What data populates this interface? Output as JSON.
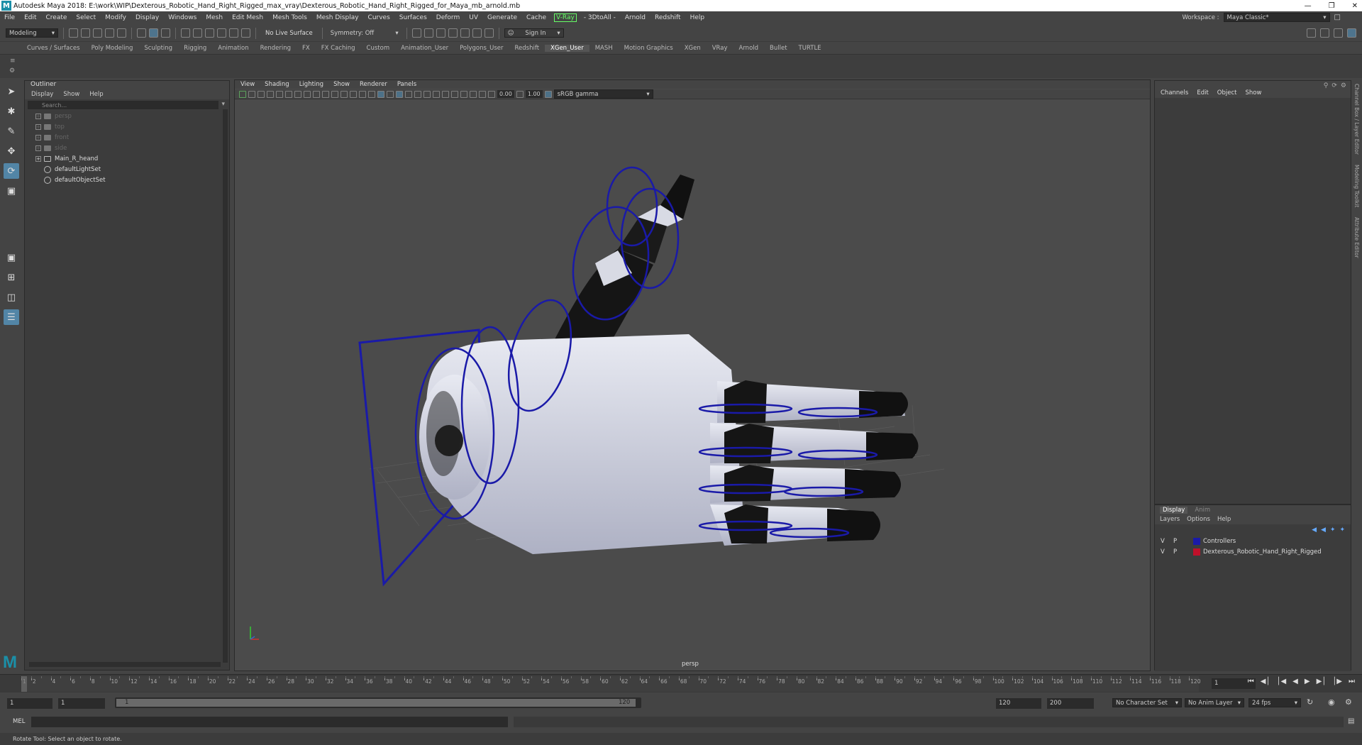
{
  "window": {
    "title": "Autodesk Maya 2018: E:\\work\\WIP\\Dexterous_Robotic_Hand_Right_Rigged_max_vray\\Dexterous_Robotic_Hand_Right_Rigged_for_Maya_mb_arnold.mb",
    "logo": "M"
  },
  "menubar": [
    "File",
    "Edit",
    "Create",
    "Select",
    "Modify",
    "Display",
    "Windows",
    "Mesh",
    "Edit Mesh",
    "Mesh Tools",
    "Mesh Display",
    "Curves",
    "Surfaces",
    "Deform",
    "UV",
    "Generate",
    "Cache",
    "V-Ray",
    "- 3DtoAll -",
    "Arnold",
    "Redshift",
    "Help"
  ],
  "workspace": {
    "label": "Workspace :",
    "value": "Maya Classic*"
  },
  "statusline": {
    "mode": "Modeling",
    "live_surface": "No Live Surface",
    "symmetry": "Symmetry: Off",
    "sign_in": "Sign In"
  },
  "shelf_tabs": [
    "Curves / Surfaces",
    "Poly Modeling",
    "Sculpting",
    "Rigging",
    "Animation",
    "Rendering",
    "FX",
    "FX Caching",
    "Custom",
    "Animation_User",
    "Polygons_User",
    "Redshift",
    "XGen_User",
    "MASH",
    "Motion Graphics",
    "XGen",
    "VRay",
    "Arnold",
    "Bullet",
    "TURTLE"
  ],
  "shelf_active": "XGen_User",
  "outliner": {
    "title": "Outliner",
    "menus": [
      "Display",
      "Show",
      "Help"
    ],
    "search_placeholder": "Search...",
    "items": [
      {
        "label": "persp",
        "dim": true,
        "type": "camera"
      },
      {
        "label": "top",
        "dim": true,
        "type": "camera"
      },
      {
        "label": "front",
        "dim": true,
        "type": "camera"
      },
      {
        "label": "side",
        "dim": true,
        "type": "camera"
      },
      {
        "label": "Main_R_heand",
        "dim": false,
        "type": "group"
      },
      {
        "label": "defaultLightSet",
        "dim": false,
        "type": "set"
      },
      {
        "label": "defaultObjectSet",
        "dim": false,
        "type": "set"
      }
    ]
  },
  "viewport": {
    "menus": [
      "View",
      "Shading",
      "Lighting",
      "Show",
      "Renderer",
      "Panels"
    ],
    "exposure": "0.00",
    "gamma": "1.00",
    "color_space": "sRGB gamma",
    "camera_label": "persp"
  },
  "channelbox": {
    "menus": [
      "Channels",
      "Edit",
      "Object",
      "Show"
    ],
    "layer_tabs": [
      "Display",
      "Anim"
    ],
    "layer_menus": [
      "Layers",
      "Options",
      "Help"
    ],
    "layers": [
      {
        "v": "V",
        "p": "P",
        "name": "Controllers",
        "color": "#1a1aa8"
      },
      {
        "v": "V",
        "p": "P",
        "name": "Dexterous_Robotic_Hand_Right_Rigged",
        "color": "#c0102a"
      }
    ],
    "side_tabs": [
      "Channel Box / Layer Editor",
      "Modeling Toolkit",
      "Attribute Editor"
    ]
  },
  "timeline": {
    "tick_labels": [
      "1",
      "2",
      "4",
      "6",
      "8",
      "10",
      "12",
      "14",
      "16",
      "18",
      "20",
      "22",
      "24",
      "26",
      "28",
      "30",
      "32",
      "34",
      "36",
      "38",
      "40",
      "42",
      "44",
      "46",
      "48",
      "50",
      "52",
      "54",
      "56",
      "58",
      "60",
      "62",
      "64",
      "66",
      "68",
      "70",
      "72",
      "74",
      "76",
      "78",
      "80",
      "82",
      "84",
      "86",
      "88",
      "90",
      "92",
      "94",
      "96",
      "98",
      "100",
      "102",
      "104",
      "106",
      "108",
      "110",
      "112",
      "114",
      "116",
      "118",
      "120"
    ],
    "current_frame": "1"
  },
  "range": {
    "start": "1",
    "anim_start": "1",
    "slider_start": "1",
    "slider_end": "120",
    "end": "120",
    "anim_end": "200",
    "character_set": "No Character Set",
    "anim_layer": "No Anim Layer",
    "fps": "24 fps"
  },
  "cmdline": {
    "label": "MEL"
  },
  "helpline": "Rotate Tool: Select an object to rotate.",
  "colors": {
    "accent": "#5285a6",
    "controller": "#1a1aa8",
    "vray": "#66ff66"
  }
}
